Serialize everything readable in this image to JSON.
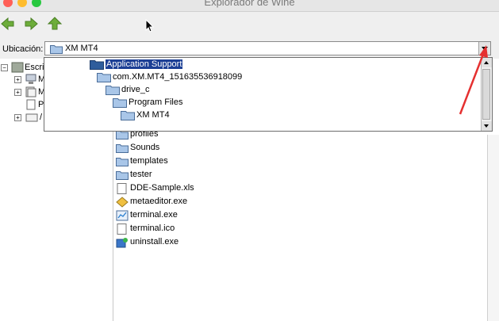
{
  "window": {
    "title": "Explorador de Wine"
  },
  "toolbar": {
    "icons": [
      "back-arrow-icon",
      "forward-arrow-icon",
      "up-arrow-icon"
    ],
    "colors": {
      "arrow_green": "#6dad3a"
    }
  },
  "address": {
    "label": "Ubicación:",
    "value": "XM MT4"
  },
  "dropdown": {
    "items": [
      {
        "label": "Application Support",
        "selected": true
      },
      {
        "label": "com.XM.MT4_151635536918099",
        "selected": false
      },
      {
        "label": "drive_c",
        "selected": false
      },
      {
        "label": "Program Files",
        "selected": false
      },
      {
        "label": "XM MT4",
        "selected": false
      }
    ],
    "selection_color": "#1c3f95"
  },
  "tree": {
    "items": [
      {
        "label": "Escrit",
        "expander": "−"
      },
      {
        "label": "M",
        "expander": "+"
      },
      {
        "label": "M",
        "expander": "+"
      },
      {
        "label": "P",
        "expander": ""
      },
      {
        "label": "/",
        "expander": "+"
      }
    ]
  },
  "files": [
    {
      "name": "profiles",
      "icon": "folder-icon"
    },
    {
      "name": "Sounds",
      "icon": "folder-icon"
    },
    {
      "name": "templates",
      "icon": "folder-icon"
    },
    {
      "name": "tester",
      "icon": "folder-icon"
    },
    {
      "name": "DDE-Sample.xls",
      "icon": "document-icon"
    },
    {
      "name": "metaeditor.exe",
      "icon": "metaeditor-icon"
    },
    {
      "name": "terminal.exe",
      "icon": "terminal-exe-icon"
    },
    {
      "name": "terminal.ico",
      "icon": "document-icon"
    },
    {
      "name": "uninstall.exe",
      "icon": "uninstall-icon"
    }
  ],
  "annotation": {
    "color": "#e53030"
  }
}
